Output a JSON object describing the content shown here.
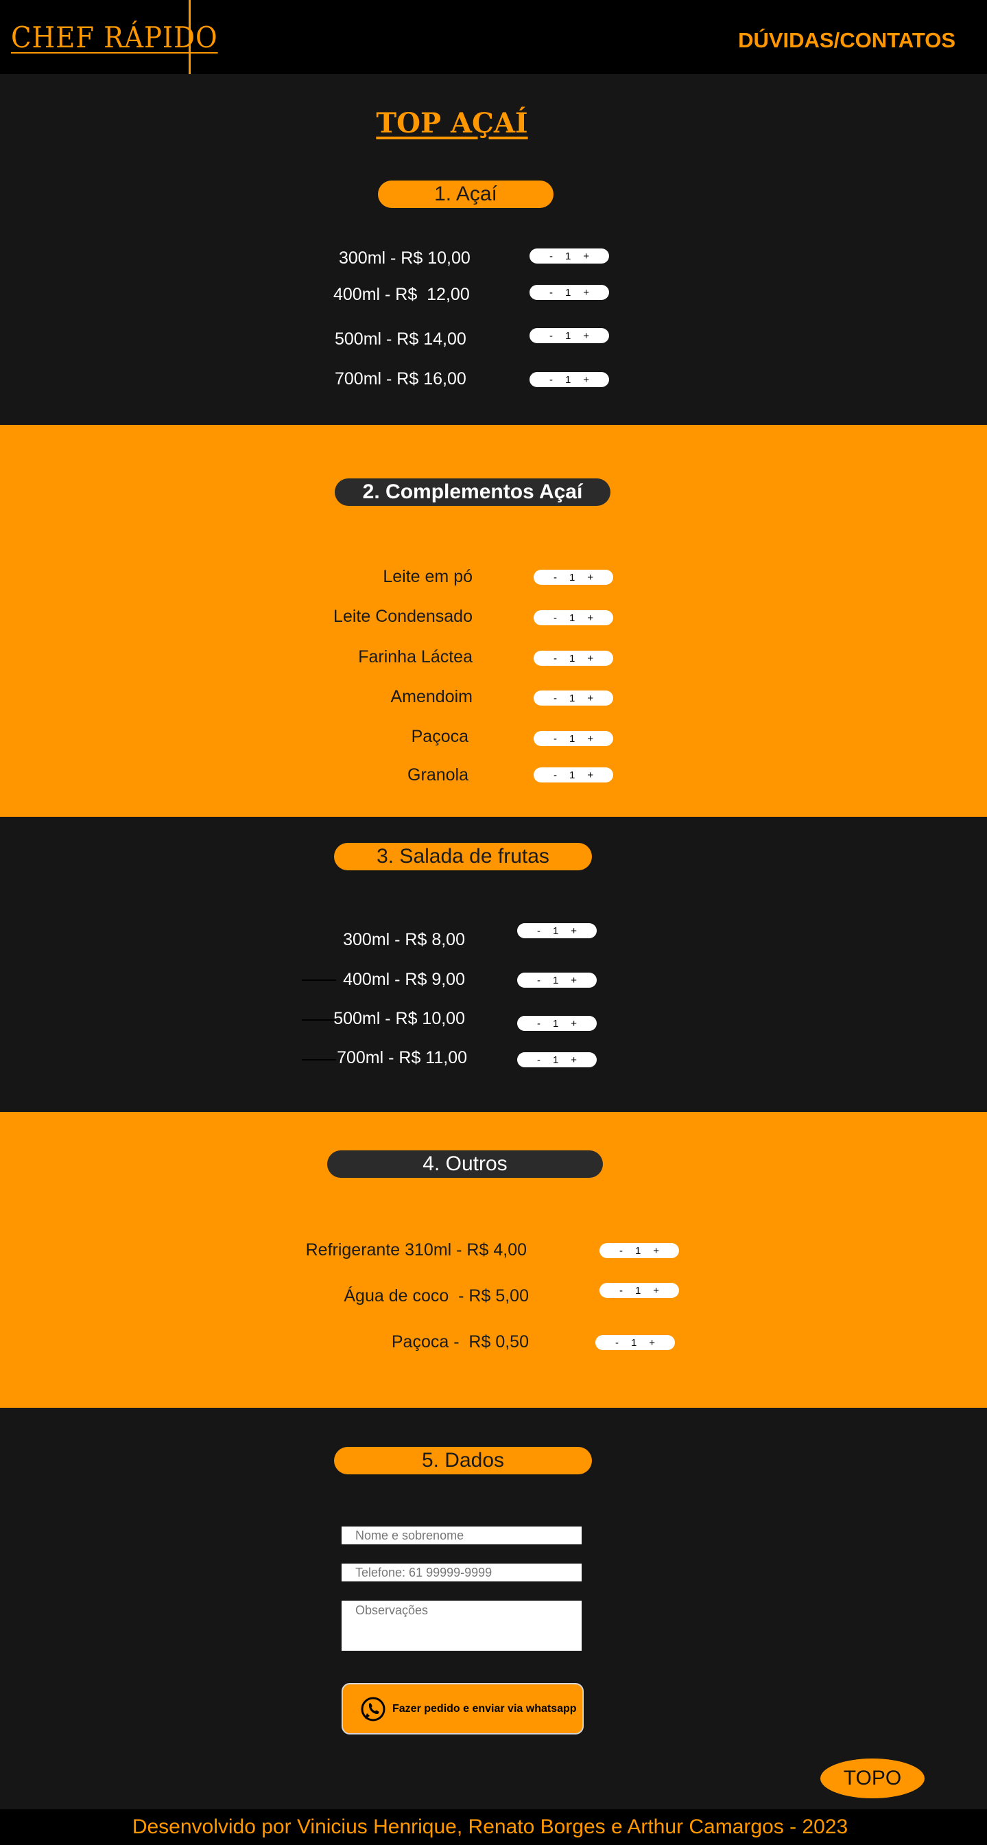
{
  "header": {
    "logo": "CHEF RÁPIDO",
    "nav_link": "DÚVIDAS/CONTATOS"
  },
  "page_title": "TOP AÇAÍ",
  "stepper": {
    "minus": "-",
    "plus": "+"
  },
  "sections": {
    "acai": {
      "title": "1. Açaí",
      "items": [
        {
          "label": "300ml - R$ 10,00",
          "qty": "1"
        },
        {
          "label": "400ml - R$  12,00",
          "qty": "1"
        },
        {
          "label": "500ml - R$ 14,00",
          "qty": "1"
        },
        {
          "label": "700ml - R$ 16,00",
          "qty": "1"
        }
      ]
    },
    "complementos": {
      "title": "2. Complementos Açaí",
      "items": [
        {
          "label": "Leite em pó",
          "qty": "1"
        },
        {
          "label": "Leite Condensado",
          "qty": "1"
        },
        {
          "label": "Farinha Láctea",
          "qty": "1"
        },
        {
          "label": "Amendoim",
          "qty": "1"
        },
        {
          "label": "Paçoca",
          "qty": "1"
        },
        {
          "label": "Granola",
          "qty": "1"
        }
      ]
    },
    "salada": {
      "title": "3. Salada de frutas",
      "items": [
        {
          "label": "300ml - R$ 8,00",
          "qty": "1"
        },
        {
          "label": "400ml - R$ 9,00",
          "qty": "1"
        },
        {
          "label": "500ml - R$ 10,00",
          "qty": "1"
        },
        {
          "label": "700ml - R$ 11,00",
          "qty": "1"
        }
      ]
    },
    "outros": {
      "title": "4. Outros",
      "items": [
        {
          "label": "Refrigerante 310ml - R$ 4,00",
          "qty": "1"
        },
        {
          "label": "Água de coco  - R$ 5,00",
          "qty": "1"
        },
        {
          "label": "Paçoca -  R$ 0,50",
          "qty": "1"
        }
      ]
    },
    "dados": {
      "title": "5. Dados",
      "name_placeholder": "Nome e sobrenome",
      "phone_placeholder": "Telefone: 61 99999-9999",
      "notes_placeholder": "Observações",
      "submit_label": "Fazer pedido e enviar via whatsapp"
    }
  },
  "top_button": "TOPO",
  "footer": "Desenvolvido por Vinicius Henrique, Renato Borges e Arthur Camargos - 2023",
  "colors": {
    "accent": "#ff9600",
    "background": "#161616",
    "header": "#000000"
  }
}
